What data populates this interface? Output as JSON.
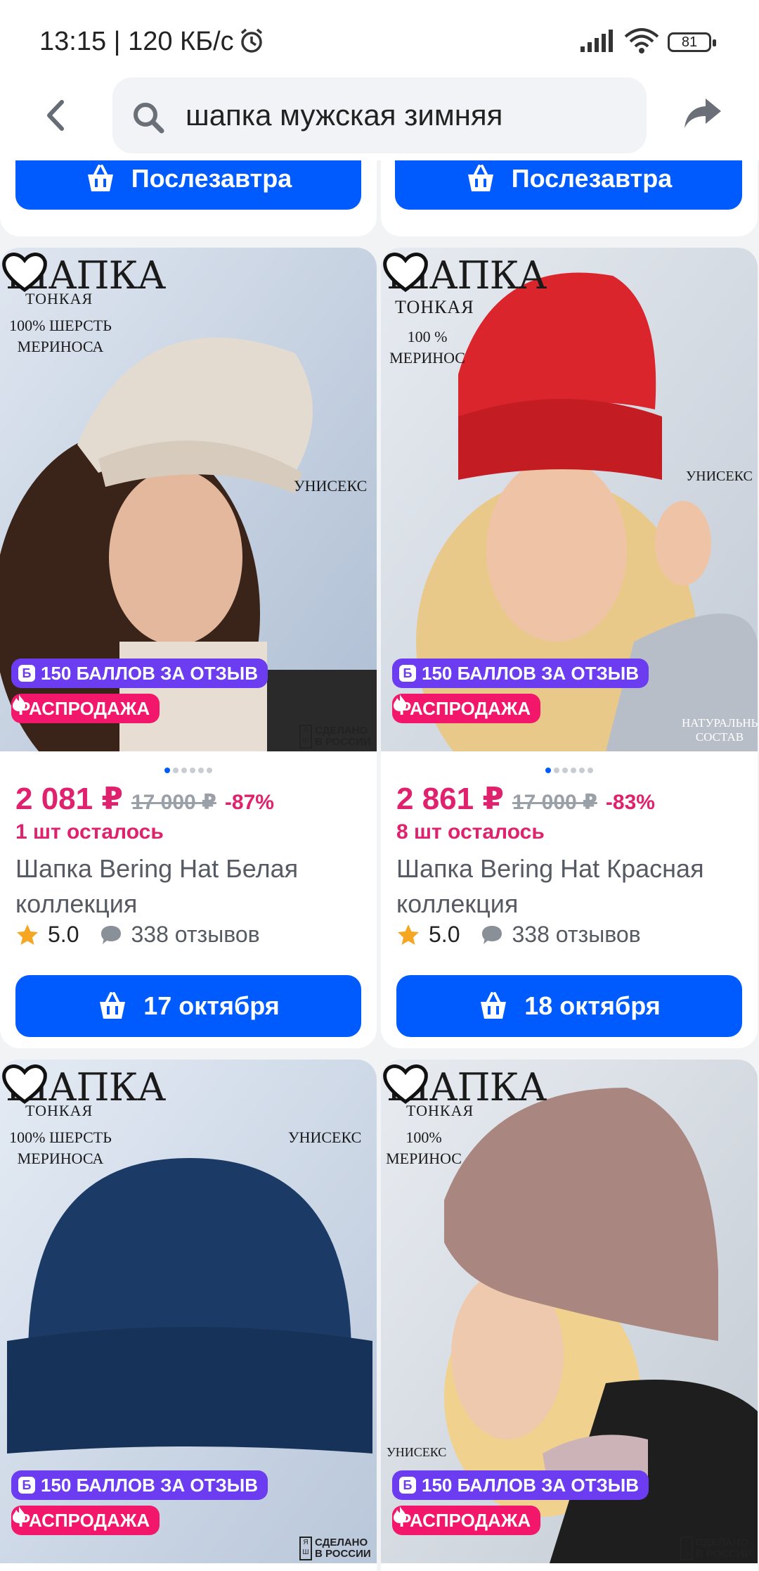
{
  "status_bar": {
    "time": "13:15 | 120 КБ/с",
    "battery": "81"
  },
  "header": {
    "search_query": "шапка мужская зимняя"
  },
  "top_partial": {
    "left_delivery": "Послезавтра",
    "right_delivery": "Послезавтра"
  },
  "products": [
    {
      "brand_title": "ШАПКА",
      "brand_sub": "ТОНКАЯ",
      "photo_note": "100% ШЕРСТЬ МЕРИНОСА",
      "photo_side": "УНИСЕКС",
      "points_badge": "150 БАЛЛОВ ЗА ОТЗЫВ",
      "points_icon": "Б",
      "sale_badge": "РАСПРОДАЖА",
      "made_in": "СДЕЛАНО В РОССИИ",
      "price": "2 081 ₽",
      "old_price": "17 000 ₽",
      "discount": "-87%",
      "stock": "1 шт осталось",
      "title": "Шапка Bering Hat Белая коллекция",
      "rating": "5.0",
      "reviews": "338 отзывов",
      "delivery": "17 октября"
    },
    {
      "brand_title": "ШАПКА",
      "brand_sub": "ТОНКАЯ",
      "photo_note": "100 % МЕРИНОС",
      "photo_side": "УНИСЕКС",
      "photo_side2": "НАТУРАЛЬНЫЙ СОСТАВ",
      "points_badge": "150 БАЛЛОВ ЗА ОТЗЫВ",
      "points_icon": "Б",
      "sale_badge": "РАСПРОДАЖА",
      "price": "2 861 ₽",
      "old_price": "17 000 ₽",
      "discount": "-83%",
      "stock": "8 шт осталось",
      "title": "Шапка Bering Hat Красная коллекция",
      "rating": "5.0",
      "reviews": "338 отзывов",
      "delivery": "18 октября"
    },
    {
      "brand_title": "ШАПКА",
      "brand_sub": "ТОНКАЯ",
      "photo_note": "100% ШЕРСТЬ МЕРИНОСА",
      "photo_side": "УНИСЕКС",
      "points_badge": "150 БАЛЛОВ ЗА ОТЗЫВ",
      "points_icon": "Б",
      "sale_badge": "РАСПРОДАЖА",
      "made_in": "СДЕЛАНО В РОССИИ"
    },
    {
      "brand_title": "ШАПКА",
      "brand_sub": "ТОНКАЯ",
      "photo_note": "100% МЕРИНОС",
      "photo_side": "УНИСЕКС",
      "points_badge": "150 БАЛЛОВ ЗА ОТЗЫВ",
      "points_icon": "Б",
      "sale_badge": "РАСПРОДАЖА",
      "made_in": "СДЕЛАНО В РОССИИ"
    }
  ],
  "colors": {
    "accent": "#005bff",
    "price": "#e0216e",
    "points_badge": "#6b3cf0",
    "sale_badge": "#f2176b"
  }
}
